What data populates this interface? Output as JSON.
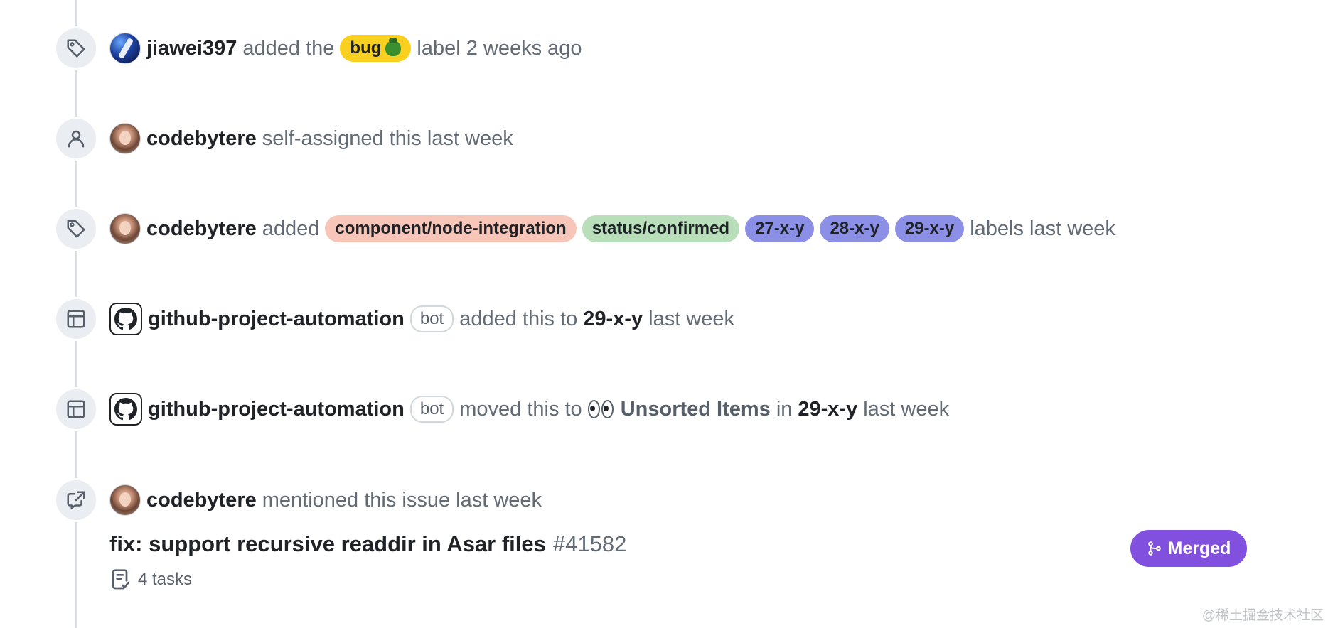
{
  "colors": {
    "timeline": "#d8dee4",
    "merged": "#8250df",
    "bug_label": "#f9d01f",
    "component_label": "#f7c6b9",
    "status_label": "#b8dfba",
    "version_label": "#8b8fe6"
  },
  "events": [
    {
      "icon": "tag-icon",
      "actor": "jiawei397",
      "text_before": "added the",
      "label": "bug",
      "text_after": "label 2 weeks ago"
    },
    {
      "icon": "person-icon",
      "actor": "codebytere",
      "text": "self-assigned this last week"
    },
    {
      "icon": "tag-icon",
      "actor": "codebytere",
      "text_before": "added",
      "labels": [
        "component/node-integration",
        "status/confirmed",
        "27-x-y",
        "28-x-y",
        "29-x-y"
      ],
      "text_after": "labels last week"
    },
    {
      "icon": "table-icon",
      "actor": "github-project-automation",
      "bot": "bot",
      "text_before": "added this to",
      "project": "29-x-y",
      "text_after": "last week"
    },
    {
      "icon": "table-icon",
      "actor": "github-project-automation",
      "bot": "bot",
      "text_before": "moved this to",
      "column": "Unsorted Items",
      "text_in": "in",
      "project": "29-x-y",
      "text_after": "last week"
    },
    {
      "icon": "cross-reference-icon",
      "actor": "codebytere",
      "text": "mentioned this issue last week"
    }
  ],
  "pull_request": {
    "title": "fix: support recursive readdir in Asar files",
    "number": "#41582",
    "tasks": "4 tasks",
    "status": "Merged"
  },
  "watermark": "@稀土掘金技术社区"
}
